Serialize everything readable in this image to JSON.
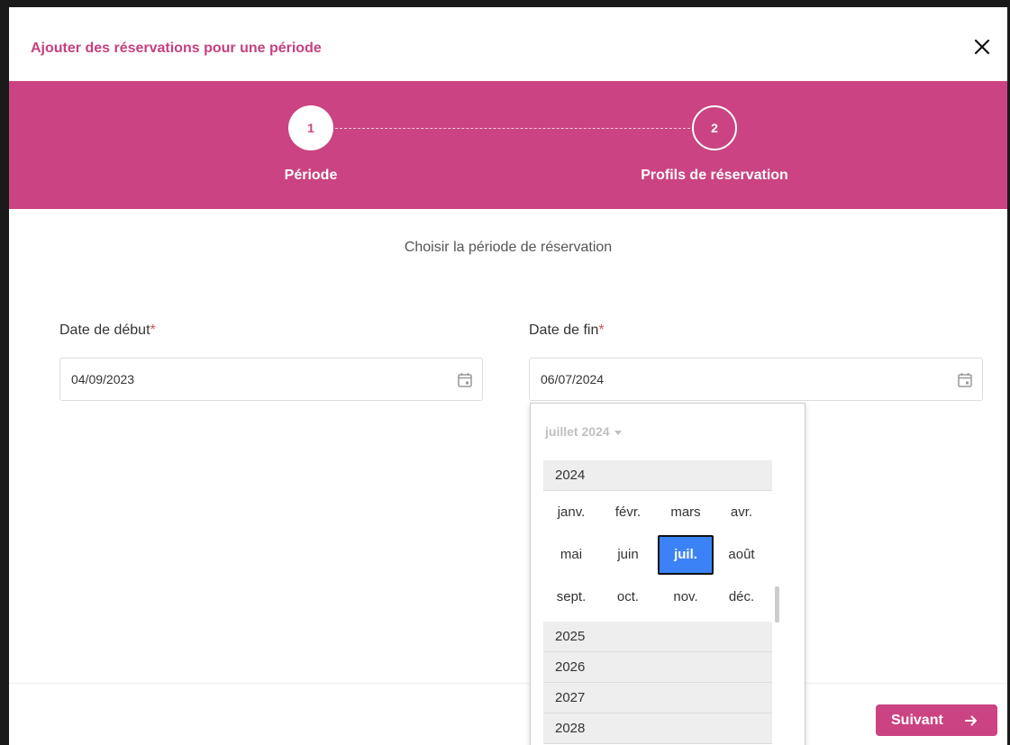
{
  "dialog": {
    "title": "Ajouter des réservations pour une période",
    "close_icon": "close-icon"
  },
  "colors": {
    "brand": "#cb4382",
    "title": "#c5417f",
    "selected": "#3b82f6"
  },
  "stepper": {
    "steps": [
      {
        "number": "1",
        "label": "Période",
        "state": "active"
      },
      {
        "number": "2",
        "label": "Profils de réservation",
        "state": "inactive"
      }
    ]
  },
  "form": {
    "subtitle": "Choisir la période de réservation",
    "start": {
      "label": "Date de début",
      "required_mark": "*",
      "value": "04/09/2023",
      "icon": "calendar-icon"
    },
    "end": {
      "label": "Date de fin",
      "required_mark": "*",
      "value": "06/07/2024",
      "icon": "calendar-icon"
    }
  },
  "datepicker": {
    "header": "juillet 2024",
    "current_year": "2024",
    "months": [
      "janv.",
      "févr.",
      "mars",
      "avr.",
      "mai",
      "juin",
      "juil.",
      "août",
      "sept.",
      "oct.",
      "nov.",
      "déc."
    ],
    "selected_month": "juil.",
    "other_years": [
      "2025",
      "2026",
      "2027",
      "2028"
    ]
  },
  "footer": {
    "next_label": "Suivant",
    "next_icon": "arrow-right-icon"
  }
}
